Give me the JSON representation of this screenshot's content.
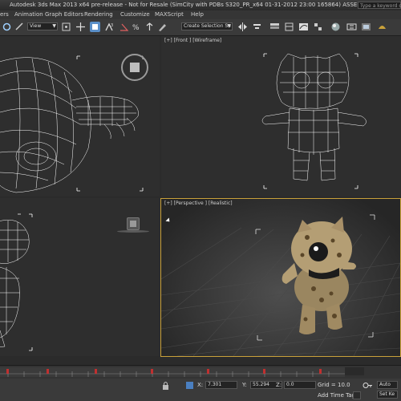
{
  "titlebar": {
    "title": "Autodesk 3ds Max 2013 x64 pre-release - Not for Resale (SimCity with PDBs S320_PR_x64 01-31-2012 23:00 165864) ASSERTSnOff   Untitled",
    "search_placeholder": "Type a keyword or"
  },
  "menubar": {
    "items": [
      "ers",
      "Animation",
      "Graph Editors",
      "Rendering",
      "Customize",
      "MAXScript",
      "Help"
    ]
  },
  "toolbar": {
    "view_dropdown": "View",
    "selection_set_dropdown": "Create Selection Se"
  },
  "viewports": {
    "front_label": "[+] [Front ] [Wireframe]",
    "perspective_label": "[+] [Perspective ] [Realistic]"
  },
  "statusbar": {
    "x_label": "X:",
    "x_value": "7.301",
    "y_label": "Y:",
    "y_value": "55.294",
    "z_label": "Z:",
    "z_value": "0.0",
    "grid_label": "Grid = 10.0",
    "add_time_tag": "Add Time Tag",
    "set_key": "Set Ke",
    "auto_key": "Auto"
  },
  "colors": {
    "active_viewport_border": "#c9a13a",
    "viewport_bg": "#2e2e2e",
    "wireframe": "#ffffff",
    "key_marker": "#c03030"
  }
}
